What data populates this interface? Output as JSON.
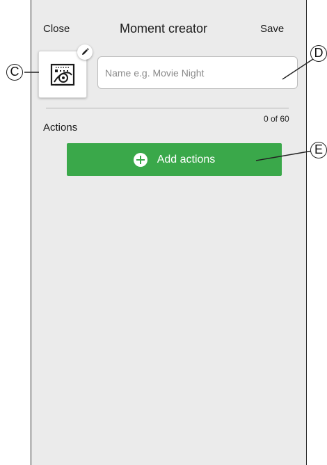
{
  "header": {
    "close_label": "Close",
    "title": "Moment creator",
    "save_label": "Save"
  },
  "icon_tile": {
    "icon": "moment-icon",
    "edit_icon": "pencil-icon"
  },
  "name_field": {
    "value": "",
    "placeholder": "Name e.g. Movie Night"
  },
  "actions": {
    "label": "Actions",
    "count": "0 of 60",
    "add_button_label": "Add actions",
    "add_icon": "plus-circle-icon"
  },
  "callouts": {
    "c": "C",
    "d": "D",
    "e": "E"
  },
  "colors": {
    "screen_background": "#ebebeb",
    "accent_green": "#3aa84a",
    "input_border": "#bcbcbc"
  }
}
